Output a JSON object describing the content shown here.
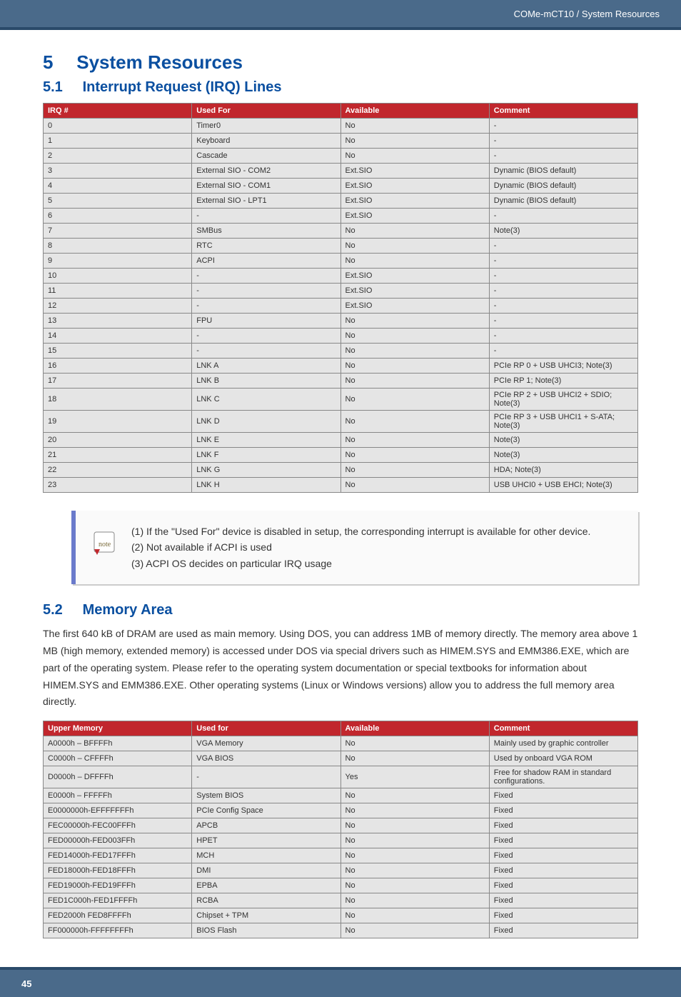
{
  "header": {
    "breadcrumb": "COMe-mCT10 / System Resources"
  },
  "footer": {
    "page": "45"
  },
  "chapter": {
    "num": "5",
    "title": "System Resources",
    "s1": {
      "num": "5.1",
      "title": "Interrupt Request (IRQ) Lines"
    },
    "s2": {
      "num": "5.2",
      "title": "Memory Area",
      "para": "The first 640 kB of DRAM are used as main memory. Using DOS, you can address 1MB of memory directly. The memory area above 1 MB (high memory, extended memory) is accessed under DOS via special drivers such as HIMEM.SYS and EMM386.EXE, which are part of the operating system. Please refer to the operating system documentation or special textbooks for information about HIMEM.SYS and EMM386.EXE. Other operating systems (Linux or Windows versions) allow you to address the full memory area directly."
    }
  },
  "note": {
    "l1": "(1) If the \"Used For\" device is disabled in setup, the corresponding interrupt is available for other device.",
    "l2": "(2) Not available if ACPI is used",
    "l3": "(3) ACPI OS decides on particular IRQ usage"
  },
  "irq": {
    "headers": [
      "IRQ #",
      "Used For",
      "Available",
      "Comment"
    ],
    "rows": [
      [
        "0",
        "Timer0",
        "No",
        "-"
      ],
      [
        "1",
        "Keyboard",
        "No",
        "-"
      ],
      [
        "2",
        "Cascade",
        "No",
        "-"
      ],
      [
        "3",
        "External SIO - COM2",
        "Ext.SIO",
        "Dynamic (BIOS default)"
      ],
      [
        "4",
        "External SIO - COM1",
        "Ext.SIO",
        "Dynamic (BIOS default)"
      ],
      [
        "5",
        "External SIO - LPT1",
        "Ext.SIO",
        "Dynamic (BIOS default)"
      ],
      [
        "6",
        "-",
        "Ext.SIO",
        "-"
      ],
      [
        "7",
        "SMBus",
        "No",
        "Note(3)"
      ],
      [
        "8",
        "RTC",
        "No",
        "-"
      ],
      [
        "9",
        "ACPI",
        "No",
        "-"
      ],
      [
        "10",
        "-",
        "Ext.SIO",
        "-"
      ],
      [
        "11",
        "-",
        "Ext.SIO",
        "-"
      ],
      [
        "12",
        "-",
        "Ext.SIO",
        "-"
      ],
      [
        "13",
        "FPU",
        "No",
        "-"
      ],
      [
        "14",
        "-",
        "No",
        "-"
      ],
      [
        "15",
        "-",
        "No",
        "-"
      ],
      [
        "16",
        "LNK A",
        "No",
        "PCIe RP 0 + USB UHCI3; Note(3)"
      ],
      [
        "17",
        "LNK B",
        "No",
        "PCIe RP 1; Note(3)"
      ],
      [
        "18",
        "LNK C",
        "No",
        "PCIe RP 2 + USB UHCI2 + SDIO; Note(3)"
      ],
      [
        "19",
        "LNK D",
        "No",
        "PCIe RP 3 + USB UHCI1 + S-ATA; Note(3)"
      ],
      [
        "20",
        "LNK E",
        "No",
        "Note(3)"
      ],
      [
        "21",
        "LNK F",
        "No",
        "Note(3)"
      ],
      [
        "22",
        "LNK G",
        "No",
        "HDA; Note(3)"
      ],
      [
        "23",
        "LNK H",
        "No",
        "USB UHCI0 + USB EHCI; Note(3)"
      ]
    ]
  },
  "mem": {
    "headers": [
      "Upper Memory",
      "Used for",
      "Available",
      "Comment"
    ],
    "rows": [
      [
        "A0000h – BFFFFh",
        "VGA Memory",
        "No",
        "Mainly used by graphic controller"
      ],
      [
        "C0000h – CFFFFh",
        "VGA BIOS",
        "No",
        "Used by onboard VGA ROM"
      ],
      [
        "D0000h – DFFFFh",
        "-",
        "Yes",
        "Free for shadow RAM in standard configurations."
      ],
      [
        "E0000h – FFFFFh",
        "System BIOS",
        "No",
        "Fixed"
      ],
      [
        "E0000000h-EFFFFFFFh",
        "PCIe Config Space",
        "No",
        "Fixed"
      ],
      [
        "FEC00000h-FEC00FFFh",
        "APCB",
        "No",
        "Fixed"
      ],
      [
        "FED00000h-FED003FFh",
        "HPET",
        "No",
        "Fixed"
      ],
      [
        "FED14000h-FED17FFFh",
        "MCH",
        "No",
        "Fixed"
      ],
      [
        "FED18000h-FED18FFFh",
        "DMI",
        "No",
        "Fixed"
      ],
      [
        "FED19000h-FED19FFFh",
        "EPBA",
        "No",
        "Fixed"
      ],
      [
        "FED1C000h-FED1FFFFh",
        "RCBA",
        "No",
        "Fixed"
      ],
      [
        "FED2000h FED8FFFFh",
        "Chipset + TPM",
        "No",
        "Fixed"
      ],
      [
        "FF000000h-FFFFFFFFh",
        "BIOS Flash",
        "No",
        "Fixed"
      ]
    ]
  }
}
